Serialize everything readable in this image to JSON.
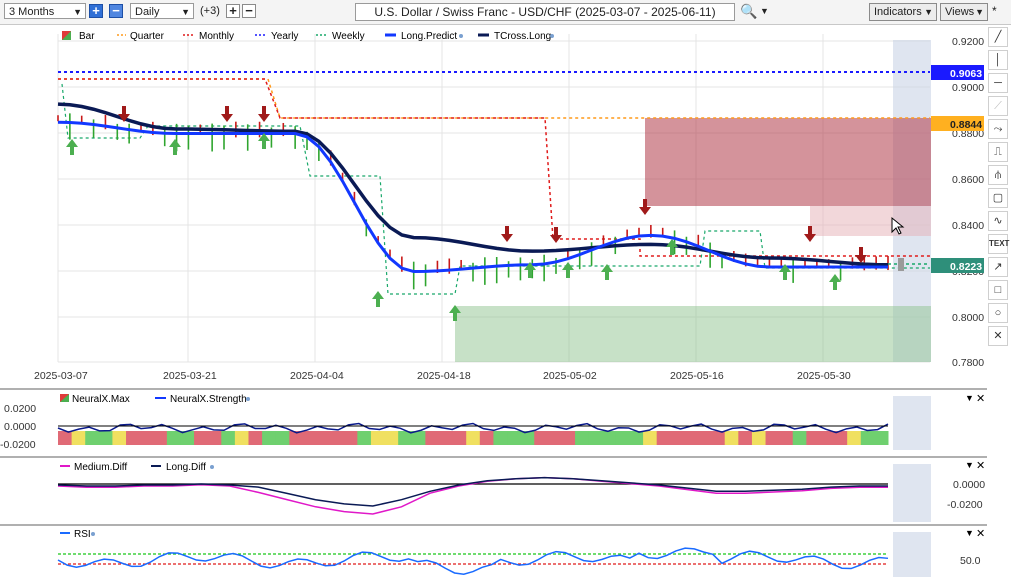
{
  "toolbar": {
    "period": "3 Months",
    "interval": "Daily",
    "extra": "(+3)",
    "title": "U.S. Dollar / Swiss Franc - USD/CHF (2025-03-07 - 2025-06-11)",
    "indicators": "Indicators",
    "views": "Views",
    "search_icon": "search-icon",
    "star": "*"
  },
  "legend": {
    "bar": "Bar",
    "quarter": "Quarter",
    "monthly": "Monthly",
    "yearly": "Yearly",
    "weekly": "Weekly",
    "long_predict": "Long.Predict",
    "tcross_long": "TCross.Long"
  },
  "price_axis": [
    "0.9200",
    "0.9000",
    "0.8800",
    "0.8600",
    "0.8400",
    "0.8200",
    "0.8000",
    "0.7800"
  ],
  "price_labels": {
    "yearly": "0.9063",
    "quarter": "0.8844",
    "last": "0.8223"
  },
  "date_axis": [
    "2025-03-07",
    "2025-03-21",
    "2025-04-04",
    "2025-04-18",
    "2025-05-02",
    "2025-05-16",
    "2025-05-30"
  ],
  "neural_panel": {
    "max_label": "NeuralX.Max",
    "strength_label": "NeuralX.Strength",
    "ticks": [
      "0.0200",
      "0.0000",
      "-0.0200"
    ]
  },
  "diff_panel": {
    "medium_label": "Medium.Diff",
    "long_label": "Long.Diff",
    "ticks": [
      "0.0000",
      "-0.0200"
    ]
  },
  "rsi_panel": {
    "label": "RSI",
    "ticks": [
      "50.0"
    ]
  },
  "colors": {
    "yearly": "#1a1aff",
    "quarter": "#ff9a1a",
    "monthly": "#e01b1b",
    "weekly": "#19a86a",
    "long_predict": "#1238ff",
    "tcross": "#0a1a55",
    "up_arrow": "#4caf50",
    "down_arrow": "#a01a1a"
  },
  "chart_data": {
    "type": "line",
    "title": "U.S. Dollar / Swiss Franc - USD/CHF (2025-03-07 - 2025-06-11)",
    "ylim": [
      0.78,
      0.925
    ],
    "x": [
      "2025-03-07",
      "2025-03-21",
      "2025-04-04",
      "2025-04-18",
      "2025-05-02",
      "2025-05-16",
      "2025-05-30",
      "2025-06-11"
    ],
    "series": [
      {
        "name": "Long.Predict",
        "values": [
          0.886,
          0.881,
          0.881,
          0.82,
          0.823,
          0.836,
          0.822,
          0.822
        ]
      },
      {
        "name": "TCross.Long",
        "values": [
          0.894,
          0.883,
          0.882,
          0.835,
          0.829,
          0.832,
          0.826,
          0.823
        ]
      },
      {
        "name": "Yearly",
        "values": [
          0.9063,
          0.9063,
          0.9063,
          0.9063,
          0.9063,
          0.9063,
          0.9063,
          0.9063
        ]
      }
    ],
    "last_price": 0.8223
  }
}
